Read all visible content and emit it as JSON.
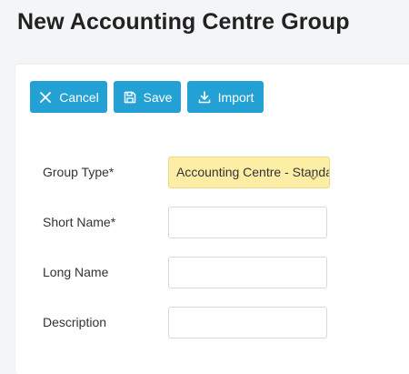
{
  "page": {
    "title": "New Accounting Centre Group"
  },
  "toolbar": {
    "cancel_label": "Cancel",
    "save_label": "Save",
    "import_label": "Import"
  },
  "form": {
    "group_type": {
      "label": "Group Type*",
      "value": "Accounting Centre - Standard"
    },
    "short_name": {
      "label": "Short Name*",
      "value": ""
    },
    "long_name": {
      "label": "Long Name",
      "value": ""
    },
    "description": {
      "label": "Description",
      "value": ""
    }
  },
  "colors": {
    "button": "#23a1d4",
    "select_highlight": "#fdeea6",
    "background": "#f3f5f7"
  },
  "icons": {
    "cancel": "close-icon",
    "save": "save-icon",
    "import": "import-icon",
    "dropdown": "chevron-down-icon"
  }
}
